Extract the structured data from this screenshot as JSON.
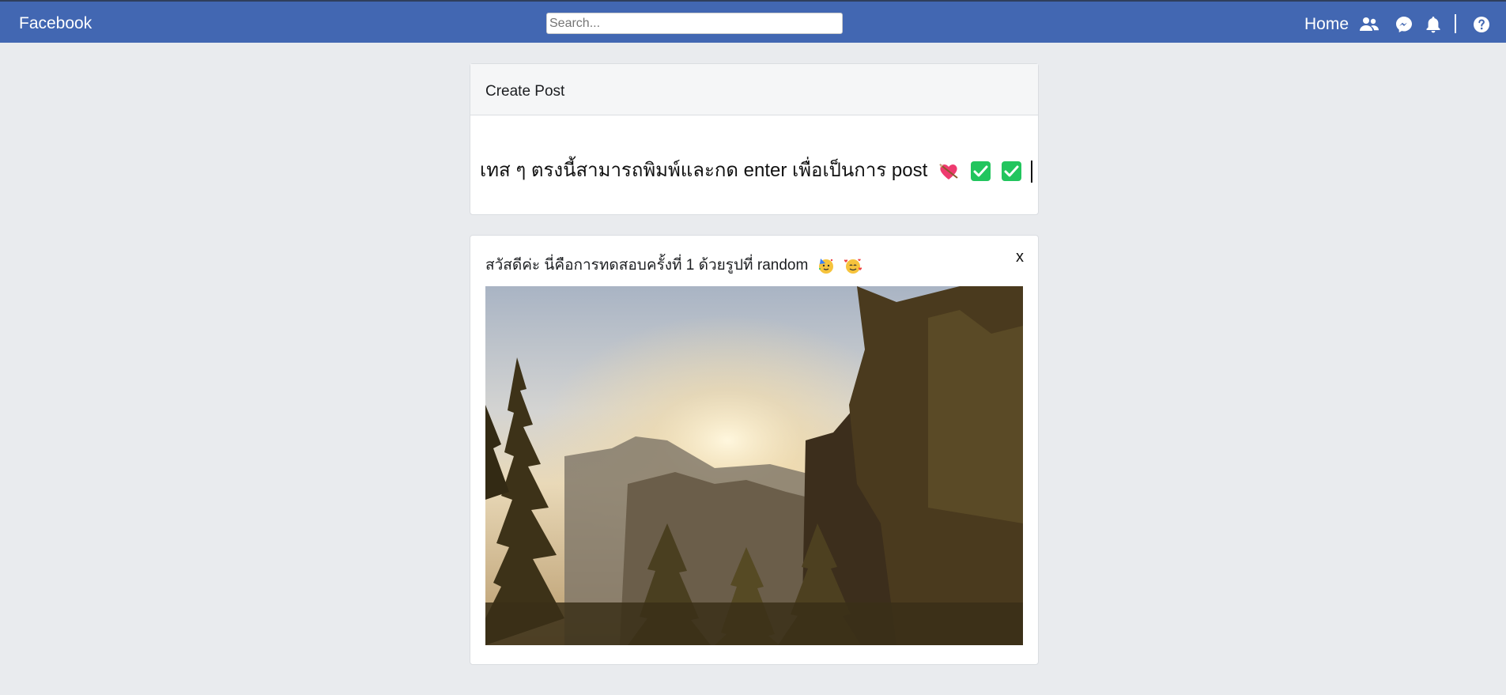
{
  "navbar": {
    "brand": "Facebook",
    "search_placeholder": "Search...",
    "home_label": "Home",
    "separator": "|",
    "icons": [
      "friends-icon",
      "messenger-icon",
      "bell-icon",
      "help-icon"
    ],
    "color": "#4267b2"
  },
  "create_post": {
    "title": "Create Post",
    "input_text": "เทส ๆ ตรงนี้สามารถพิมพ์และกด enter เพื่อเป็นการ post",
    "emojis": [
      "heart-arrow-icon",
      "check-icon",
      "check-icon"
    ]
  },
  "post": {
    "text": "สวัสดีค่ะ นี่คือการทดสอบครั้งที่ 1 ด้วยรูปที่ random",
    "emojis": [
      "party-face-icon",
      "smiling-hearts-icon"
    ],
    "close_label": "x",
    "image_alt": "mountain-forest-sunrise"
  }
}
